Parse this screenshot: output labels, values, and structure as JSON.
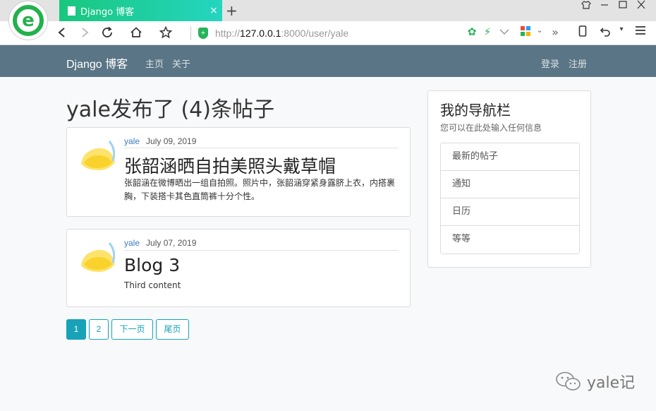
{
  "browser": {
    "tab_title": "Django 博客",
    "tab_close": "×",
    "new_tab": "+",
    "url_protocol": "http://",
    "url_host": "127.0.0.1",
    "url_path": ":8000/user/yale"
  },
  "site": {
    "brand": "Django 博客",
    "nav_links": [
      "主页",
      "关于"
    ],
    "auth_links": [
      "登录",
      "注册"
    ]
  },
  "main": {
    "title": "yale发布了 (4)条帖子",
    "posts": [
      {
        "author": "yale",
        "date": "July 09, 2019",
        "title": "张韶涵晒自拍美照头戴草帽",
        "content": "张韶涵在微博晒出一组自拍照。照片中，张韶涵穿紧身露脐上衣，内搭裹胸，下装搭卡其色直筒裤十分个性。"
      },
      {
        "author": "yale",
        "date": "July 07, 2019",
        "title": "Blog 3",
        "content": "Third content"
      }
    ],
    "pagination": [
      "1",
      "2",
      "下一页",
      "尾页"
    ]
  },
  "sidebar": {
    "title": "我的导航栏",
    "subtitle": "您可以在此处输入任何信息",
    "items": [
      "最新的帖子",
      "通知",
      "日历",
      "等等"
    ]
  },
  "watermark": {
    "text": "yale记"
  },
  "colors": {
    "accent": "#17a2b8",
    "nav_bg": "#5a7585",
    "tab_gradient_start": "#19c77d",
    "tab_gradient_end": "#24d5c0"
  }
}
